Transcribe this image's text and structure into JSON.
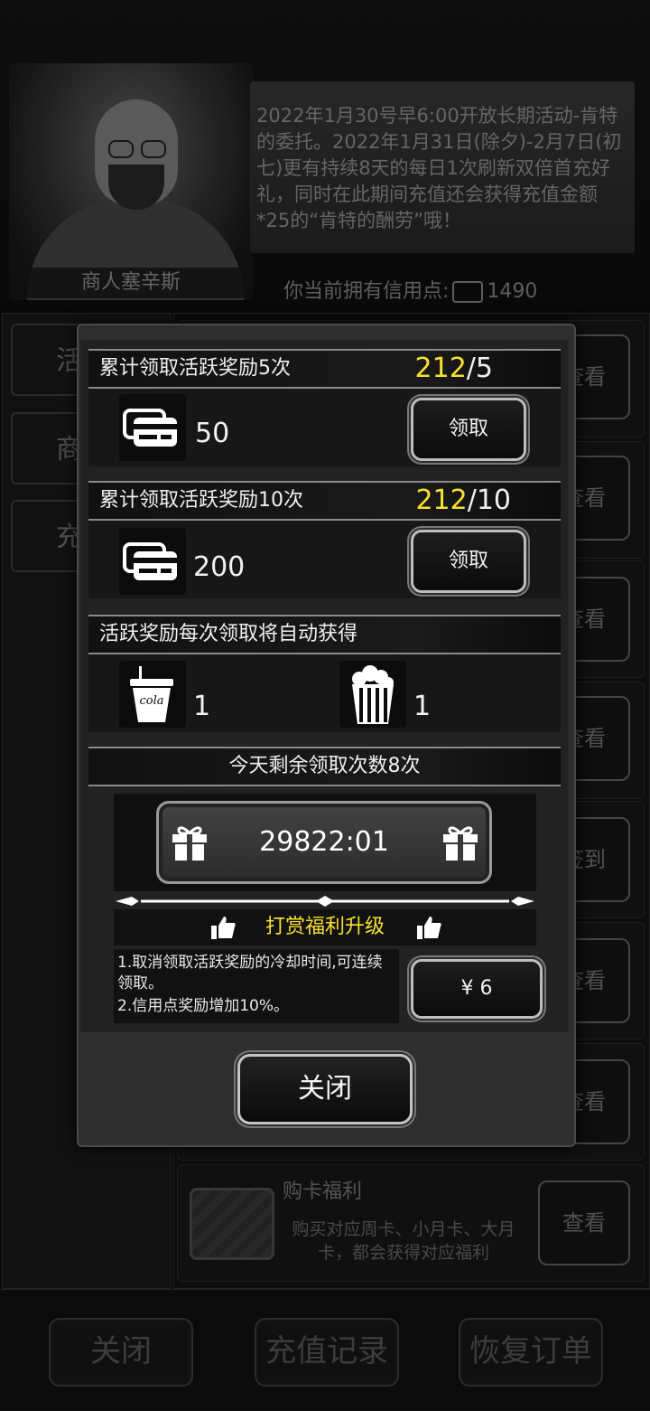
{
  "merchant": {
    "name": "商人塞辛斯",
    "notice": "2022年1月30号早6:00开放长期活动-肯特的委托。2022年1月31日(除夕)-2月7日(初七)更有持续8天的每日1次刷新双倍首充好礼，同时在此期间充值还会获得充值金额*25的“肯特的酬劳”哦！",
    "credits_label": "你当前拥有信用点:",
    "credits_value": "1490"
  },
  "left_tabs": [
    "活",
    "商",
    "充"
  ],
  "right_buttons": [
    "查看",
    "查看",
    "查看",
    "查看",
    "签到",
    "查看",
    "查看",
    "查看"
  ],
  "purchase_card": {
    "title": "购卡福利",
    "desc": "购买对应周卡、小月卡、大月卡，都会获得对应福利"
  },
  "bottom_buttons": {
    "close": "关闭",
    "records": "充值记录",
    "restore": "恢复订单"
  },
  "modal": {
    "reward1": {
      "title": "累计领取活跃奖励5次",
      "progress_current": "212",
      "progress_target": "/5",
      "amount": "50",
      "claim": "领取"
    },
    "reward2": {
      "title": "累计领取活跃奖励10次",
      "progress_current": "212",
      "progress_target": "/10",
      "amount": "200",
      "claim": "领取"
    },
    "auto_title": "活跃奖励每次领取将自动获得",
    "auto_items": [
      {
        "icon": "cola-icon",
        "label": "cola",
        "count": "1"
      },
      {
        "icon": "popcorn-icon",
        "count": "1"
      }
    ],
    "remain_title": "今天剩余领取次数8次",
    "timer": "29822:01",
    "upgrade_title": "打赏福利升级",
    "benefits": [
      "1.取消领取活跃奖励的冷却时间,可连续领取。",
      "2.信用点奖励增加10%。"
    ],
    "price": "¥ 6",
    "close": "关闭"
  },
  "colors": {
    "accent_yellow": "#f7e12f",
    "text_white": "#f2f2f2",
    "panel_dark": "#171717"
  }
}
